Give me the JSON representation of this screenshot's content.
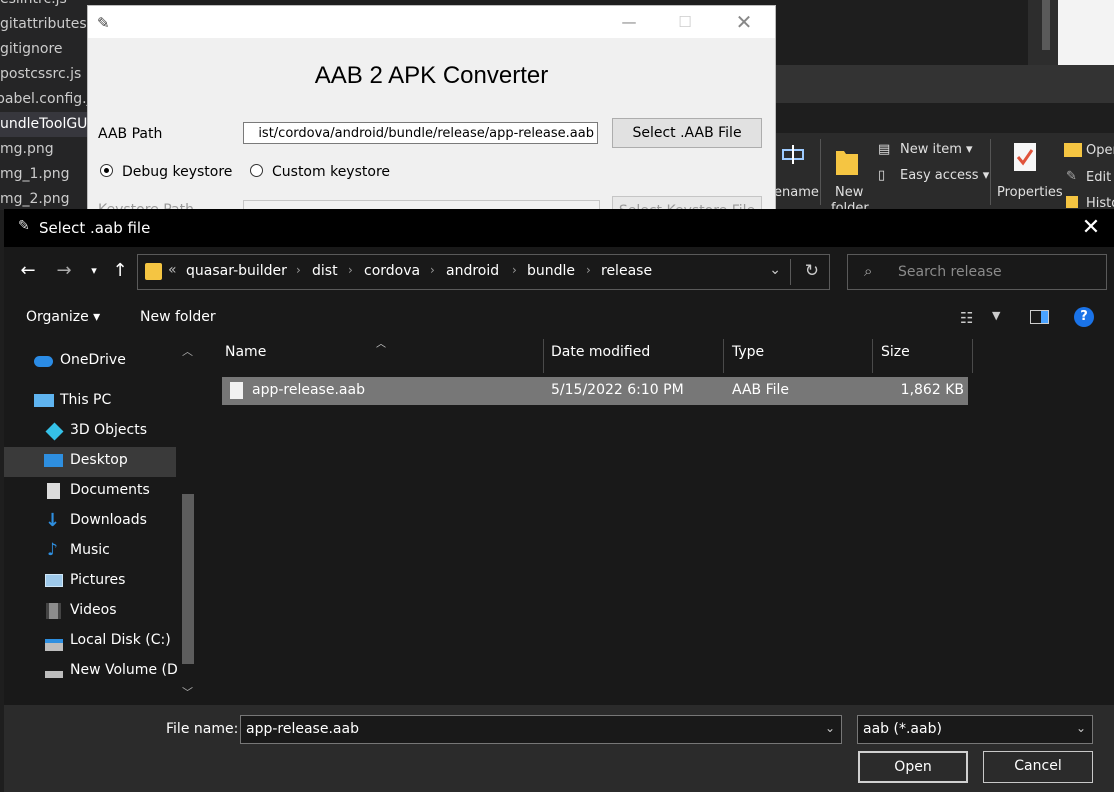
{
  "background": {
    "editor_files": [
      {
        "label": "eslintrc.js"
      },
      {
        "label": "gitattributes"
      },
      {
        "label": "gitignore"
      },
      {
        "label": "postcssrc.js"
      },
      {
        "label": "babel.config.js"
      },
      {
        "label": "undleToolGU"
      },
      {
        "label": "mg.png"
      },
      {
        "label": "mg_1.png"
      },
      {
        "label": "mg_2.png"
      }
    ],
    "ribbon": {
      "rename_label": "ename",
      "new_folder_label": "New",
      "new_folder_label2": "folder",
      "new_item_label": "New item",
      "easy_access_label": "Easy access",
      "properties_label": "Properties",
      "open_label": "Open",
      "edit_label": "Edit",
      "history_label": "Histo"
    }
  },
  "tk_window": {
    "heading": "AAB 2 APK Converter",
    "aab_path_label": "AAB Path",
    "aab_path_value": "ist/cordova/android/bundle/release/app-release.aab",
    "select_aab_button": "Select .AAB File",
    "radio_debug": "Debug keystore",
    "radio_custom": "Custom keystore",
    "keystore_path_label": "Keystore Path",
    "select_keystore_button": "Select Keystore File"
  },
  "dialog": {
    "title": "Select .aab file",
    "breadcrumbs": [
      "quasar-builder",
      "dist",
      "cordova",
      "android",
      "bundle",
      "release"
    ],
    "breadcrumb_overflow": "«",
    "search_placeholder": "Search release",
    "organize_label": "Organize",
    "new_folder_label": "New folder",
    "nav_items": [
      {
        "label": "OneDrive",
        "icon": "cloud-icon"
      },
      {
        "label": "This PC",
        "icon": "computer-icon"
      },
      {
        "label": "3D Objects",
        "icon": "cube-icon"
      },
      {
        "label": "Desktop",
        "icon": "desktop-icon"
      },
      {
        "label": "Documents",
        "icon": "document-icon"
      },
      {
        "label": "Downloads",
        "icon": "download-icon"
      },
      {
        "label": "Music",
        "icon": "music-icon"
      },
      {
        "label": "Pictures",
        "icon": "picture-icon"
      },
      {
        "label": "Videos",
        "icon": "video-icon"
      },
      {
        "label": "Local Disk (C:)",
        "icon": "drive-icon"
      },
      {
        "label": "New Volume (D:)",
        "icon": "drive-icon"
      }
    ],
    "columns": {
      "name": "Name",
      "date": "Date modified",
      "type": "Type",
      "size": "Size"
    },
    "files": [
      {
        "name": "app-release.aab",
        "date": "5/15/2022 6:10 PM",
        "type": "AAB File",
        "size": "1,862 KB"
      }
    ],
    "file_name_label": "File name:",
    "file_name_value": "app-release.aab",
    "file_type_value": "aab (*.aab)",
    "open_button": "Open",
    "cancel_button": "Cancel"
  },
  "colors": {
    "accent": "#1a73e8",
    "folder": "#f5c542",
    "selection": "#777777"
  }
}
